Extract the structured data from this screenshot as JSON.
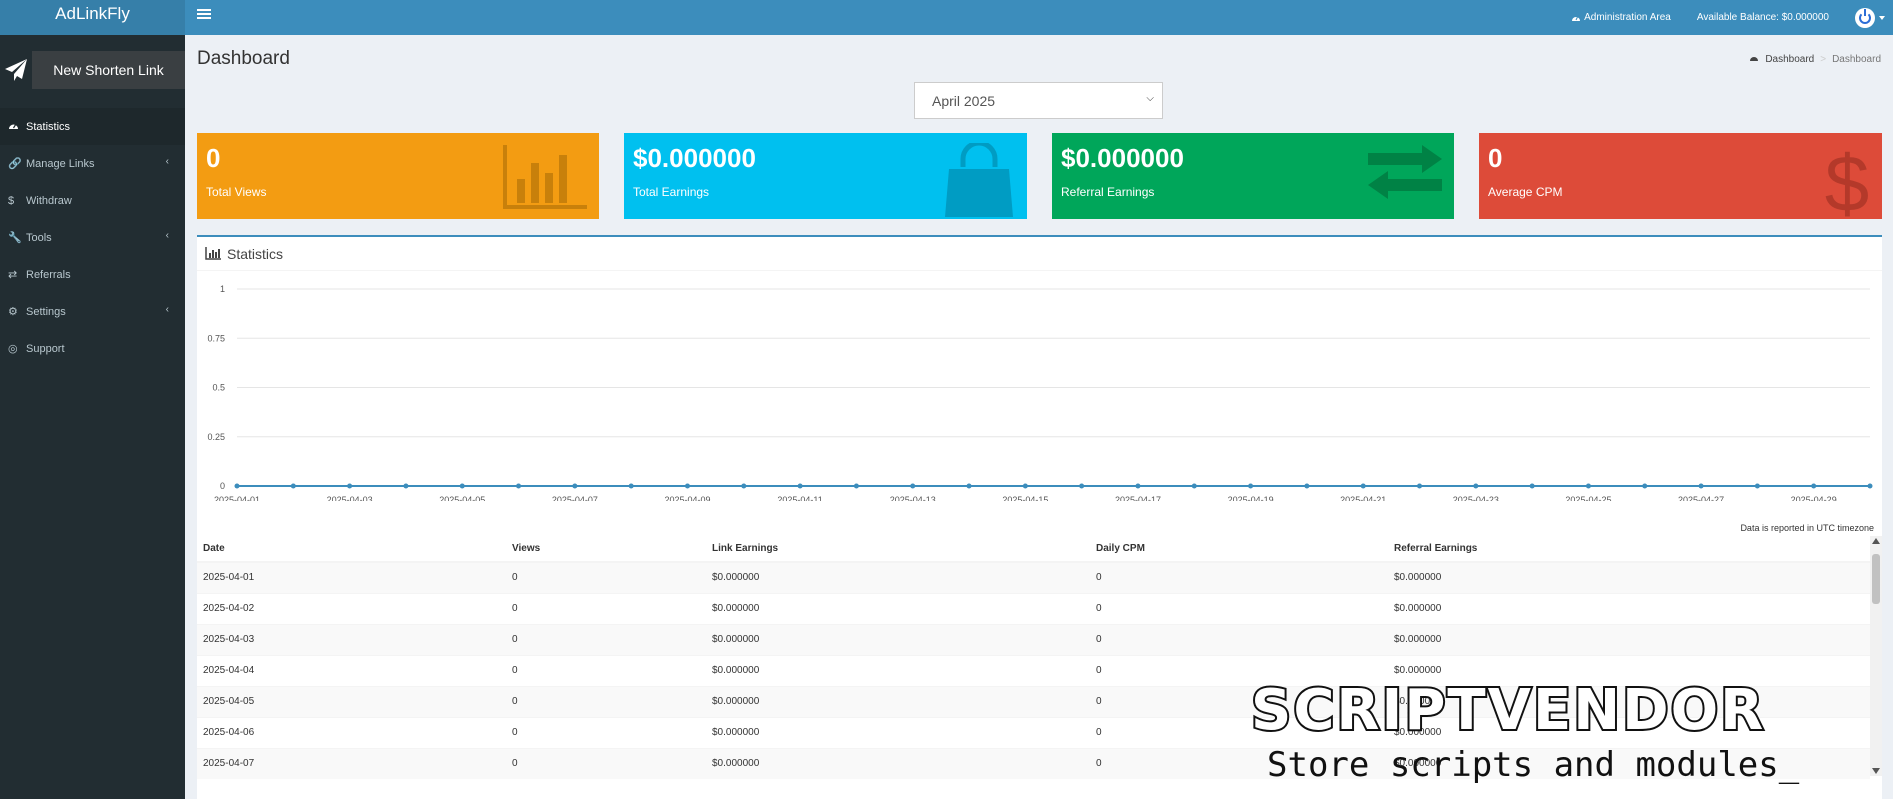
{
  "app": {
    "logo": "AdLinkFly"
  },
  "topbar": {
    "admin_area": "Administration Area",
    "balance": "Available Balance: $0.000000"
  },
  "sidebar": {
    "new_link_label": "New Shorten Link",
    "items": [
      {
        "label": "Statistics",
        "icon": "dashboard-icon",
        "active": true
      },
      {
        "label": "Manage Links",
        "icon": "link-icon",
        "has_submenu": true
      },
      {
        "label": "Withdraw",
        "icon": "dollar-icon"
      },
      {
        "label": "Tools",
        "icon": "wrench-icon",
        "has_submenu": true
      },
      {
        "label": "Referrals",
        "icon": "exchange-icon"
      },
      {
        "label": "Settings",
        "icon": "gears-icon",
        "has_submenu": true
      },
      {
        "label": "Support",
        "icon": "life-ring-icon"
      }
    ]
  },
  "header": {
    "title": "Dashboard",
    "breadcrumb": [
      "Dashboard",
      "Dashboard"
    ]
  },
  "month_select": {
    "selected": "April 2025"
  },
  "stat_boxes": [
    {
      "value": "0",
      "label": "Total Views",
      "color": "#f39c12",
      "icon": "bar-chart-icon"
    },
    {
      "value": "$0.000000",
      "label": "Total Earnings",
      "color": "#00c0ef",
      "icon": "shopping-bag-icon"
    },
    {
      "value": "$0.000000",
      "label": "Referral Earnings",
      "color": "#00a65a",
      "icon": "exchange-icon"
    },
    {
      "value": "0",
      "label": "Average CPM",
      "color": "#dd4b39",
      "icon": "dollar-icon"
    }
  ],
  "stats_panel": {
    "title": "Statistics",
    "utc_note": "Data is reported in UTC timezone"
  },
  "chart_data": {
    "type": "line",
    "x": [
      "2025-04-01",
      "2025-04-02",
      "2025-04-03",
      "2025-04-04",
      "2025-04-05",
      "2025-04-06",
      "2025-04-07",
      "2025-04-08",
      "2025-04-09",
      "2025-04-10",
      "2025-04-11",
      "2025-04-12",
      "2025-04-13",
      "2025-04-14",
      "2025-04-15",
      "2025-04-16",
      "2025-04-17",
      "2025-04-18",
      "2025-04-19",
      "2025-04-20",
      "2025-04-21",
      "2025-04-22",
      "2025-04-23",
      "2025-04-24",
      "2025-04-25",
      "2025-04-26",
      "2025-04-27",
      "2025-04-28",
      "2025-04-29",
      "2025-04-30"
    ],
    "series": [
      {
        "values": [
          0,
          0,
          0,
          0,
          0,
          0,
          0,
          0,
          0,
          0,
          0,
          0,
          0,
          0,
          0,
          0,
          0,
          0,
          0,
          0,
          0,
          0,
          0,
          0,
          0,
          0,
          0,
          0,
          0,
          0
        ],
        "color": "#3c8dbc"
      }
    ],
    "x_tick_labels": [
      "2025-04-01",
      "2025-04-03",
      "2025-04-05",
      "2025-04-07",
      "2025-04-09",
      "2025-04-11",
      "2025-04-13",
      "2025-04-15",
      "2025-04-17",
      "2025-04-19",
      "2025-04-21",
      "2025-04-23",
      "2025-04-25",
      "2025-04-27",
      "2025-04-29"
    ],
    "y_tick_labels": [
      "0",
      "0.25",
      "0.5",
      "0.75",
      "1"
    ],
    "ylim": [
      0,
      1
    ],
    "grid": true
  },
  "table": {
    "headers": [
      "Date",
      "Views",
      "Link Earnings",
      "Daily CPM",
      "Referral Earnings"
    ],
    "rows": [
      [
        "2025-04-01",
        "0",
        "$0.000000",
        "0",
        "$0.000000"
      ],
      [
        "2025-04-02",
        "0",
        "$0.000000",
        "0",
        "$0.000000"
      ],
      [
        "2025-04-03",
        "0",
        "$0.000000",
        "0",
        "$0.000000"
      ],
      [
        "2025-04-04",
        "0",
        "$0.000000",
        "0",
        "$0.000000"
      ],
      [
        "2025-04-05",
        "0",
        "$0.000000",
        "0",
        "$0.000000"
      ],
      [
        "2025-04-06",
        "0",
        "$0.000000",
        "0",
        "$0.000000"
      ],
      [
        "2025-04-07",
        "0",
        "$0.000000",
        "0",
        "$0.000000"
      ]
    ]
  },
  "watermark": {
    "title": "SCRIPTVENDOR",
    "subtitle": "Store scripts and modules_"
  }
}
